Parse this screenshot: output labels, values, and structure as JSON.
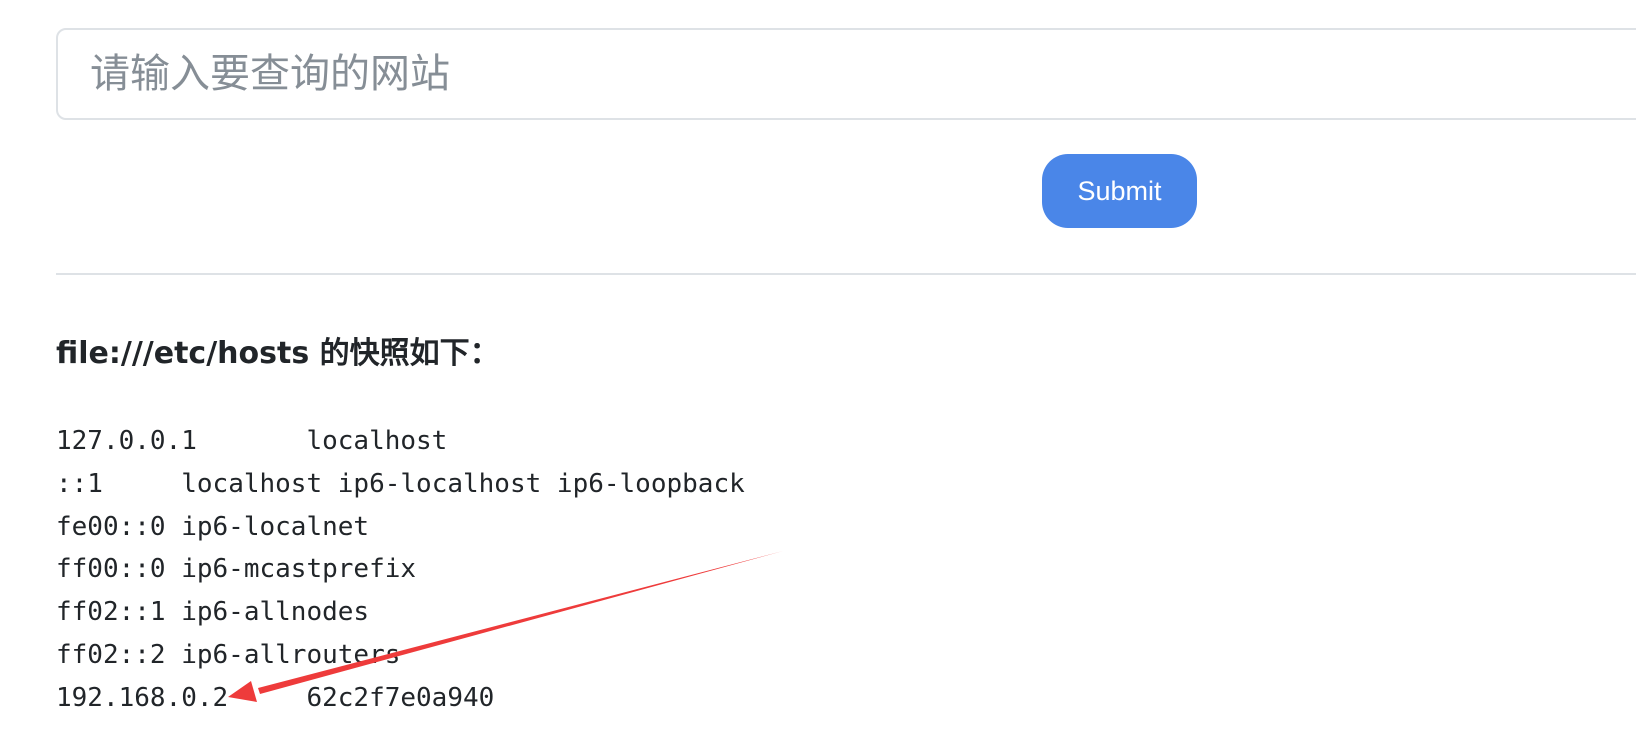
{
  "search": {
    "placeholder": "请输入要查询的网站",
    "value": ""
  },
  "submit_label": "Submit",
  "snapshot": {
    "heading": "file:///etc/hosts 的快照如下：",
    "content": "127.0.0.1\tlocalhost\n::1\tlocalhost ip6-localhost ip6-loopback\nfe00::0 ip6-localnet\nff00::0 ip6-mcastprefix\nff02::1 ip6-allnodes\nff02::2 ip6-allrouters\n192.168.0.2\t62c2f7e0a940"
  },
  "colors": {
    "accent": "#4a86e8",
    "annotation": "#ee3b3b",
    "border": "#dee2e6",
    "placeholder": "#868e96",
    "text": "#212529"
  },
  "annotation": {
    "icon": "red-arrow-icon"
  }
}
